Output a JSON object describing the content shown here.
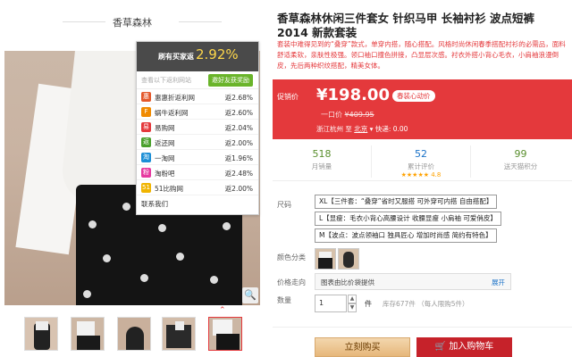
{
  "shop": {
    "name": "香草森林"
  },
  "cashback": {
    "header_label": "刷有买家返",
    "header_rate": "2.92%",
    "search_hint": "查看以下返利网站",
    "invite_button": "邀好友获奖励",
    "sites": [
      {
        "name": "惠惠折返利网",
        "rate": "返2.68%",
        "icon": "惠",
        "color": "#e4582b"
      },
      {
        "name": "蜗牛返利网",
        "rate": "返2.60%",
        "icon": "F",
        "color": "#f08a00"
      },
      {
        "name": "易购网",
        "rate": "返2.04%",
        "icon": "易",
        "color": "#e4393c"
      },
      {
        "name": "返还网",
        "rate": "返2.00%",
        "icon": "返",
        "color": "#4aa02c"
      },
      {
        "name": "一淘网",
        "rate": "返1.96%",
        "icon": "淘",
        "color": "#1c8fd6"
      },
      {
        "name": "淘粉吧",
        "rate": "返2.48%",
        "icon": "粉",
        "color": "#e63aa0"
      },
      {
        "name": "51比购网",
        "rate": "返2.00%",
        "icon": "51",
        "color": "#f0b400"
      }
    ],
    "contact": "联系我们"
  },
  "product": {
    "title": "香草森林休闲三件套女 针织马甲 长袖衬衫 波点短裤 2014 新款套装",
    "description": "套装中难得见到的“叠穿”款式，单穿内搭，随心搭配。风格时尚休闲春季搭配衬衫的必需品，面料舒适柔软，亲肤性极强。领口袖口撞色拼接，凸显层次感。衬衣外搭小背心毛衣，小肩袖浪漫倒皮，先后两种织纹搭配，精美女体。"
  },
  "price": {
    "label": "促销价",
    "value": "¥198.00",
    "promo": "春装心动价",
    "original_label": "一口价",
    "original": "¥409.95",
    "ship_from": "浙江杭州",
    "ship_to_label": "至",
    "ship_to": "北京",
    "express": "快递: 0.00"
  },
  "stats": [
    {
      "value": "518",
      "label": "月销量"
    },
    {
      "value": "52",
      "label": "累计评价",
      "stars": "★★★★★ 4.8"
    },
    {
      "value": "99",
      "label": "送天猫积分"
    }
  ],
  "size": {
    "label": "尺码",
    "options": [
      "XL【三件套：“叠穿”省时又服搭 可外穿可内搭 自由搭配】",
      "L【显瘦：毛衣小背心高腰设计 收腰显瘦 小肩袖 可爱俏皮】",
      "M【波点：波点领袖口 独具匠心 增加时尚感 简约有特色】"
    ]
  },
  "color": {
    "label": "颜色分类"
  },
  "bag": {
    "label": "价格走向",
    "text": "图表由比价袋提供",
    "expand": "展开"
  },
  "quantity": {
    "label": "数量",
    "value": "1",
    "unit": "件",
    "stock": "库存677件 （每人限购5件）",
    "up": "▲",
    "down": "▼"
  },
  "actions": {
    "buy": "立刻购买",
    "cart": "加入购物车"
  },
  "icons": {
    "zoom": "🔍",
    "up_arrow": "⌃"
  }
}
